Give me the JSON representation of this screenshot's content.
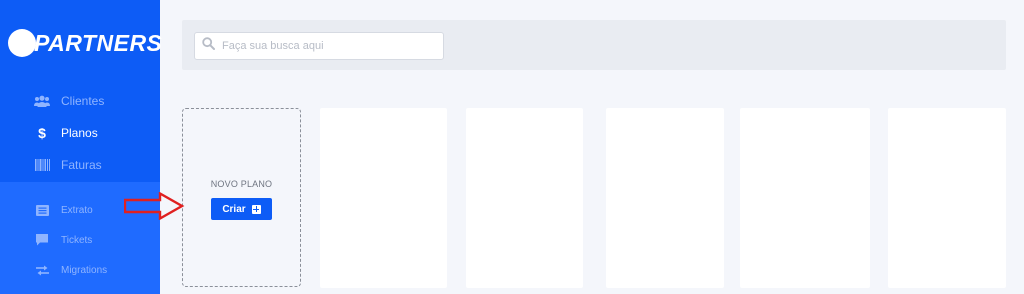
{
  "brand": {
    "name": "PARTNERS"
  },
  "sidebar": {
    "items": [
      {
        "label": "Clientes",
        "icon": "users-icon"
      },
      {
        "label": "Planos",
        "icon": "dollar-icon",
        "active": true
      },
      {
        "label": "Faturas",
        "icon": "barcode-icon"
      },
      {
        "label": "Extrato",
        "icon": "list-icon"
      },
      {
        "label": "Tickets",
        "icon": "chat-icon"
      },
      {
        "label": "Migrations",
        "icon": "swap-icon"
      }
    ]
  },
  "search": {
    "placeholder": "Faça sua busca aqui",
    "value": ""
  },
  "new_plan": {
    "title": "NOVO PLANO",
    "create_label": "Criar"
  },
  "colors": {
    "accent": "#0d5cf6",
    "sidebar_lower": "#1f6bff",
    "annotation_arrow": "#e02020"
  }
}
